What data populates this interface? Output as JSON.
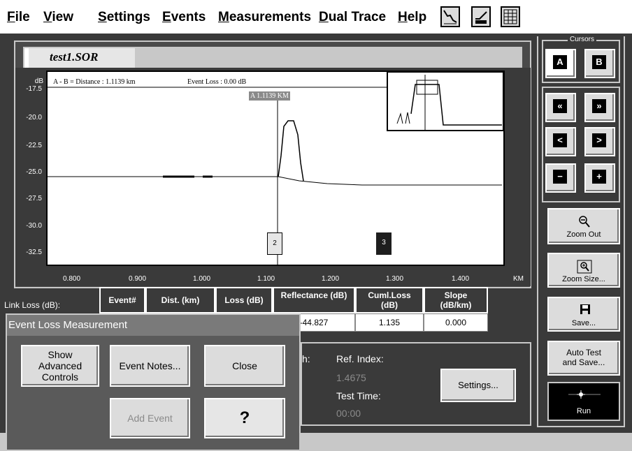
{
  "menu": {
    "items": [
      {
        "key": "file",
        "accel": "F",
        "rest": "ile"
      },
      {
        "key": "view",
        "accel": "V",
        "rest": "iew"
      },
      {
        "key": "settings",
        "accel": "S",
        "rest": "ettings"
      },
      {
        "key": "events",
        "accel": "E",
        "rest": "vents"
      },
      {
        "key": "measurements",
        "accel": "M",
        "rest": "easurements"
      },
      {
        "key": "dual_trace",
        "accel": "D",
        "rest": "ual Trace"
      },
      {
        "key": "help",
        "accel": "H",
        "rest": "elp"
      }
    ],
    "toolbar_icons": [
      "trace-view-icon",
      "table-view-icon",
      "grid-view-icon"
    ]
  },
  "trace": {
    "tab_label": "test1.SOR",
    "y_unit": "dB",
    "y_ticks": [
      "-17.5",
      "-20.0",
      "-22.5",
      "-25.0",
      "-27.5",
      "-30.0",
      "-32.5"
    ],
    "x_ticks": [
      "0.800",
      "0.900",
      "1.000",
      "1.100",
      "1.200",
      "1.300",
      "1.400"
    ],
    "x_unit": "KM",
    "readout_distance": "A - B = Distance : 1.1139 km",
    "readout_loss": "Event Loss : 0.00 dB",
    "cursor_label": "A 1.1139 KM",
    "event_markers": [
      "2",
      "3"
    ],
    "link_loss_label": "Link Loss (dB):"
  },
  "table": {
    "headers": [
      "Event#",
      "Dist. (km)",
      "Loss (dB)",
      "Reflectance (dB)",
      "Cuml.Loss (dB)",
      "Slope (dB/km)"
    ],
    "row": [
      "",
      "",
      "",
      "-44.827",
      "1.135",
      "0.000"
    ]
  },
  "cursors": {
    "title": "Cursors",
    "a_label": "A",
    "b_label": "B"
  },
  "nav_glyphs": {
    "fast_left": "«",
    "fast_right": "»",
    "left": "<",
    "right": ">",
    "minus": "−",
    "plus": "+"
  },
  "right_panel": {
    "zoom_out": "Zoom Out",
    "zoom_size": "Zoom Size...",
    "save": "Save...",
    "auto_test_line1": "Auto Test",
    "auto_test_line2": "and Save...",
    "run": "Run"
  },
  "dialog": {
    "title": "Event Loss Measurement",
    "show_advanced": [
      "Show",
      "Advanced",
      "Controls"
    ],
    "event_notes": "Event Notes...",
    "close": "Close",
    "add_event": "Add Event",
    "help": "?"
  },
  "info": {
    "partial_label": "h:",
    "ref_index_label": "Ref. Index:",
    "ref_index_value": "1.4675",
    "test_time_label": "Test Time:",
    "test_time_value": "00:00",
    "settings_button": "Settings..."
  },
  "colors": {
    "background": "#3a3a3a",
    "panel": "#dcdcdc",
    "plot": "#ffffff"
  }
}
